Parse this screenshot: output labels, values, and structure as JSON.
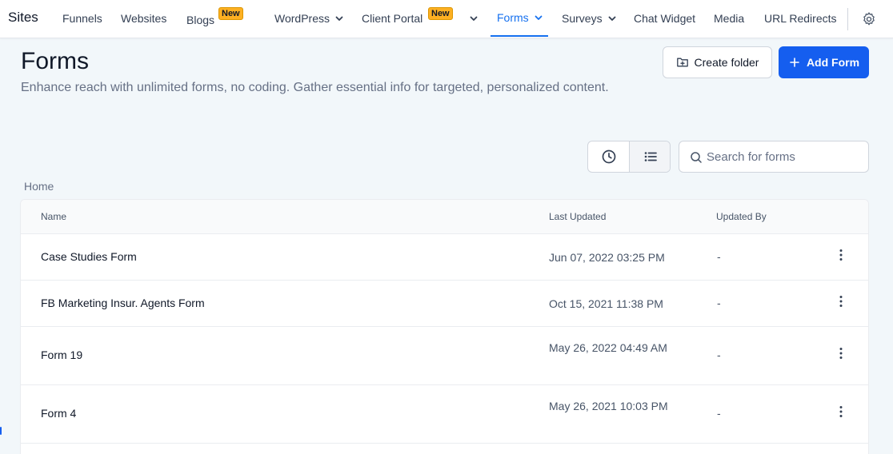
{
  "nav": {
    "title": "Sites",
    "items": [
      {
        "label": "Funnels"
      },
      {
        "label": "Websites"
      },
      {
        "label": "Blogs",
        "badge": "New"
      },
      {
        "label": "WordPress"
      },
      {
        "label": "Client Portal",
        "badge": "New"
      },
      {
        "label": "Forms",
        "active": true
      },
      {
        "label": "Surveys"
      },
      {
        "label": "Chat Widget"
      },
      {
        "label": "Media"
      },
      {
        "label": "URL Redirects"
      }
    ],
    "settings_icon": "gear-icon"
  },
  "header": {
    "title": "Forms",
    "description": "Enhance reach with unlimited forms, no coding. Gather essential info for targeted, personalized content.",
    "create_folder_label": "Create folder",
    "add_form_label": "Add Form"
  },
  "toolbar": {
    "search_placeholder": "Search for forms",
    "view_recent_icon": "clock-icon",
    "view_list_icon": "list-icon"
  },
  "breadcrumb": "Home",
  "table": {
    "columns": [
      "Name",
      "Last Updated",
      "Updated By"
    ],
    "rows": [
      {
        "name": "Case Studies Form",
        "updated": "Jun 07, 2022 03:25 PM",
        "by": "-"
      },
      {
        "name": "FB Marketing Insur. Agents Form",
        "updated": "Oct 15, 2021 11:38 PM",
        "by": "-"
      },
      {
        "name": "Form 19",
        "updated": "May 26, 2022 04:49 AM",
        "by": "-"
      },
      {
        "name": "Form 4",
        "updated": "May 26, 2021 10:03 PM",
        "by": "-"
      }
    ]
  },
  "colors": {
    "accent": "#155eef",
    "active_tab": "#1570ef",
    "badge": "#fdb022",
    "background": "#f2f7fa"
  }
}
